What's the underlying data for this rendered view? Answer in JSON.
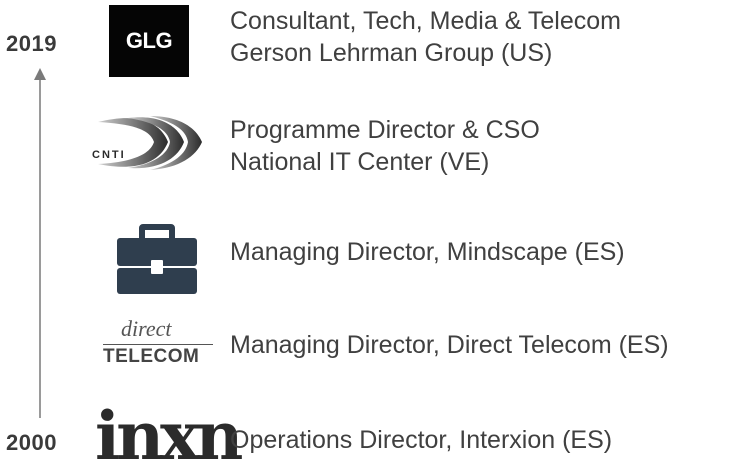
{
  "timeline": {
    "year_end": "2019",
    "year_start": "2000"
  },
  "entries": [
    {
      "logo_text": "GLG",
      "lines": [
        "Consultant, Tech, Media & Telecom",
        "Gerson Lehrman Group (US)"
      ]
    },
    {
      "logo_text": "CNTI",
      "lines": [
        "Programme Director & CSO",
        "National IT Center (VE)"
      ]
    },
    {
      "logo_icon": "briefcase-icon",
      "lines": [
        "Managing Director, Mindscape (ES)"
      ]
    },
    {
      "logo_text_top": "direct",
      "logo_text_bottom": "TELECOM",
      "lines": [
        "Managing Director, Direct Telecom (ES)"
      ]
    },
    {
      "logo_text": "inxn",
      "lines": [
        "Operations Director, Interxion (ES)"
      ]
    }
  ],
  "colors": {
    "text": "#404040",
    "briefcase": "#2f3e4e",
    "axis": "#9a9a9a"
  }
}
